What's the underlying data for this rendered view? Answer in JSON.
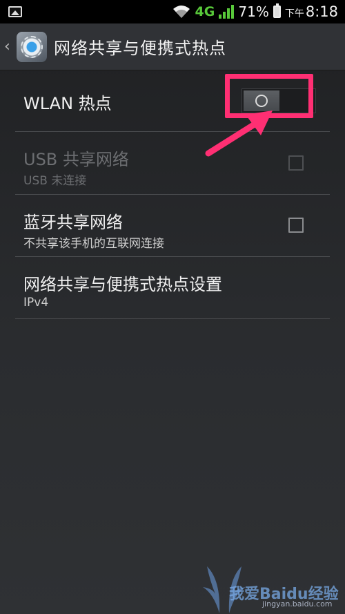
{
  "status_bar": {
    "battery_percent": "71%",
    "network": "4G",
    "time_prefix": "下午",
    "time": "8:18",
    "icons": [
      "picture-icon",
      "wifi-icon",
      "signal-icon",
      "battery-icon"
    ]
  },
  "action_bar": {
    "title": "网络共享与便携式热点",
    "icons": [
      "back-chevron-icon",
      "settings-gear-icon"
    ]
  },
  "settings": {
    "wlan_hotspot": {
      "label": "WLAN 热点",
      "enabled": false
    },
    "usb_tethering": {
      "label": "USB 共享网络",
      "summary": "USB 未连接",
      "checked": false,
      "disabled": true
    },
    "bluetooth_tethering": {
      "label": "蓝牙共享网络",
      "summary": "不共享该手机的互联网连接",
      "checked": false
    },
    "hotspot_settings": {
      "label": "网络共享与便携式热点设置",
      "summary": "IPv4"
    }
  },
  "annotation": {
    "color": "#ff2f73"
  },
  "watermark": {
    "main": "我爱Baidu经验",
    "sub": "jingyan.baidu.com"
  },
  "colors": {
    "accent_green": "#58c83a",
    "background": "#2a2c2f"
  }
}
